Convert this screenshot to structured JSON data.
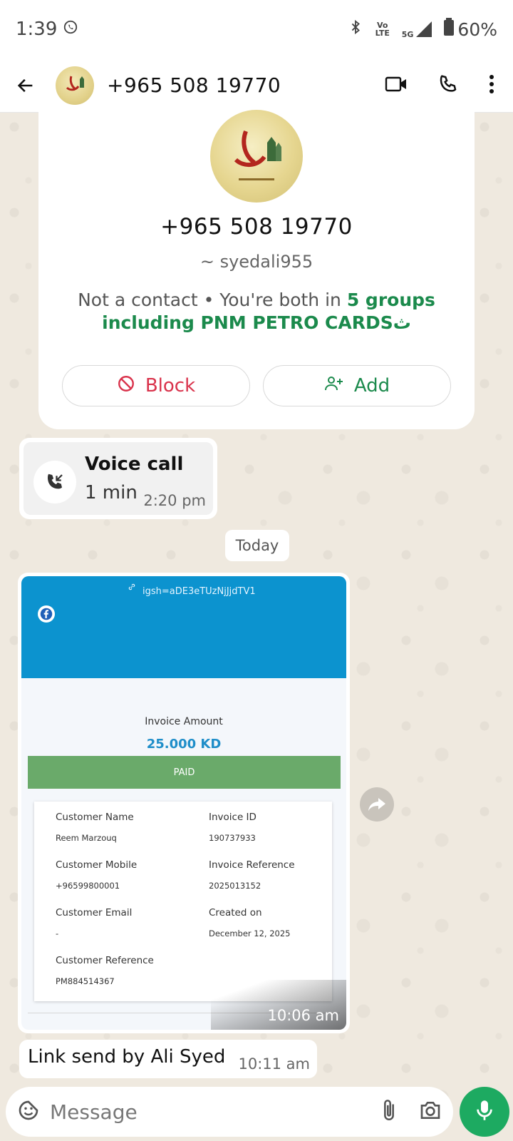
{
  "status_bar": {
    "time": "1:39",
    "battery": "60%",
    "network_label": "5G",
    "volte_label": "Vo LTE"
  },
  "header": {
    "title": "+965 508 19770"
  },
  "profile_card": {
    "phone": "+965 508 19770",
    "username": "~ syedali955",
    "info_plain": "Not a contact • You're both in ",
    "info_highlight": "5 groups including PNM PETRO CARDSث",
    "block_label": "Block",
    "add_label": "Add"
  },
  "voice_call": {
    "title": "Voice call",
    "duration": "1 min",
    "time": "2:20 pm"
  },
  "date_divider": "Today",
  "image_message": {
    "time": "10:06 am",
    "screenshot": {
      "link_text": "igsh=aDE3eTUzNjJjdTV1",
      "invoice_amount_label": "Invoice Amount",
      "invoice_amount": "25.000 KD",
      "status": "PAID",
      "fields": {
        "customer_name_label": "Customer Name",
        "customer_name": "Reem Marzouq",
        "invoice_id_label": "Invoice ID",
        "invoice_id": "190737933",
        "customer_mobile_label": "Customer Mobile",
        "customer_mobile": "+96599800001",
        "invoice_reference_label": "Invoice Reference",
        "invoice_reference": "2025013152",
        "customer_email_label": "Customer Email",
        "customer_email": "-",
        "created_on_label": "Created on",
        "created_on": "December 12, 2025",
        "customer_reference_label": "Customer Reference",
        "customer_reference": "PM884514367"
      }
    }
  },
  "text_message": {
    "text": "Link send by Ali Syed",
    "time": "10:11 am"
  },
  "composer": {
    "placeholder": "Message"
  },
  "colors": {
    "accent_green": "#1daa61",
    "link_green": "#1b8a4c",
    "block_red": "#d9324b",
    "invoice_blue": "#0c93cf",
    "paid_green": "#6aaa6a"
  }
}
